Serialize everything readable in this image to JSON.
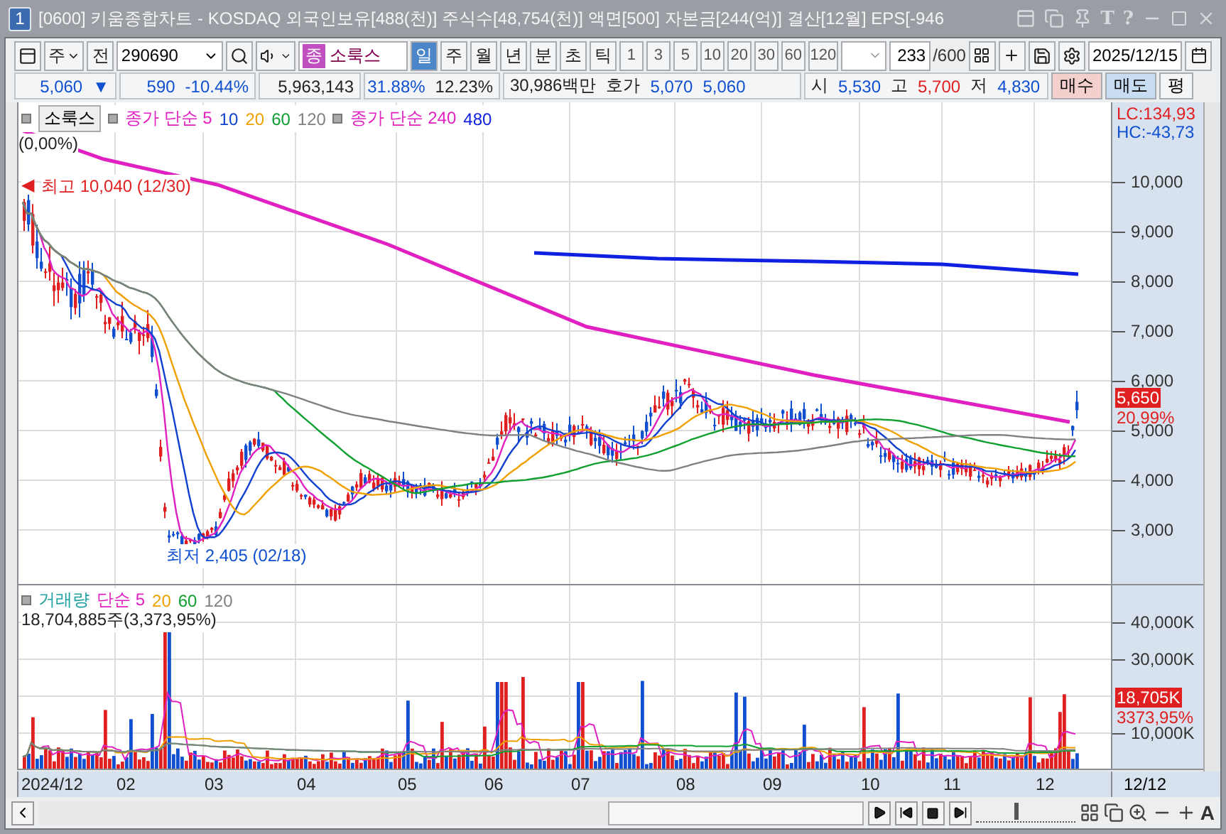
{
  "window": {
    "number": "1",
    "title": "[0600] 키움종합차트 - KOSDAQ 외국인보유[488(천)] 주식수[48,754(천)] 액면[500] 자본금[244(억)] 결산[12월] EPS[-946",
    "title_glyphs": [
      "T",
      "?"
    ]
  },
  "toolbar": {
    "market": "주",
    "prev": "전",
    "code": "290690",
    "badge": "종",
    "name": "소룩스",
    "periods": [
      {
        "label": "일",
        "selected": true
      },
      {
        "label": "주",
        "selected": false
      },
      {
        "label": "월",
        "selected": false
      },
      {
        "label": "년",
        "selected": false
      },
      {
        "label": "분",
        "selected": false
      },
      {
        "label": "초",
        "selected": false
      },
      {
        "label": "틱",
        "selected": false
      }
    ],
    "units": [
      "1",
      "3",
      "5",
      "10",
      "20",
      "30",
      "60",
      "120"
    ],
    "count": "233",
    "total": "/600",
    "date": "2025/12/15"
  },
  "quote": {
    "price": "5,060",
    "arrow": "▼",
    "change": "590",
    "change_pct": "-10.44%",
    "volume": "5,963,143",
    "ratio1": "31.88%",
    "ratio2": "12.23%",
    "amount": "30,986백만",
    "ask_label": "호가",
    "ask": "5,070",
    "bid": "5,060",
    "ohl": [
      {
        "label": "시",
        "value": "5,530",
        "kind": "down"
      },
      {
        "label": "고",
        "value": "5,700",
        "kind": "up"
      },
      {
        "label": "저",
        "value": "4,830",
        "kind": "down"
      }
    ],
    "buttons": [
      {
        "label": "매수",
        "kind": "buy"
      },
      {
        "label": "매도",
        "kind": "sell"
      },
      {
        "label": "평",
        "kind": "plain"
      }
    ]
  },
  "price_pane": {
    "legend_name": "소룩스",
    "legend": [
      {
        "label": "종가 단순 5",
        "color": "#e020c0"
      },
      {
        "label": "10",
        "color": "#1040d0"
      },
      {
        "label": "20",
        "color": "#f0a000"
      },
      {
        "label": "60",
        "color": "#10a030"
      },
      {
        "label": "120",
        "color": "#808080"
      },
      {
        "label": "종가 단순 240",
        "color": "#e020c0"
      },
      {
        "label": "480",
        "color": "#1020e0"
      }
    ],
    "pct": "(0,00%)",
    "high_marker": "◀",
    "high_note": "최고 10,040 (12/30)",
    "low_note": "최저 2,405 (02/18)",
    "lc": "LC:134,93",
    "hc": "HC:-43,73",
    "ticks": [
      "10,000",
      "9,000",
      "8,000",
      "7,000",
      "6,000",
      "5,000",
      "4,000",
      "3,000"
    ],
    "last_price": "5,650",
    "last_pct": "20,99%"
  },
  "volume_pane": {
    "legend": [
      {
        "label": "거래량",
        "color": "#20a0a0"
      },
      {
        "label": "단순 5",
        "color": "#e020c0"
      },
      {
        "label": "20",
        "color": "#f0a000"
      },
      {
        "label": "60",
        "color": "#10a030"
      },
      {
        "label": "120",
        "color": "#808080"
      }
    ],
    "summary": "18,704,885주(3,373,95%)",
    "ticks": [
      "40,000K",
      "30,000K",
      "10,000K"
    ],
    "last_volume": "18,705K",
    "last_pct": "3373,95%"
  },
  "x_axis": [
    "2024/12",
    "02",
    "03",
    "04",
    "05",
    "06",
    "07",
    "08",
    "09",
    "10",
    "11",
    "12"
  ],
  "x_axis_end": "12/12",
  "bottom_bar": {
    "zoom_label": "A",
    "slider": {
      "level": 0.4
    }
  }
}
